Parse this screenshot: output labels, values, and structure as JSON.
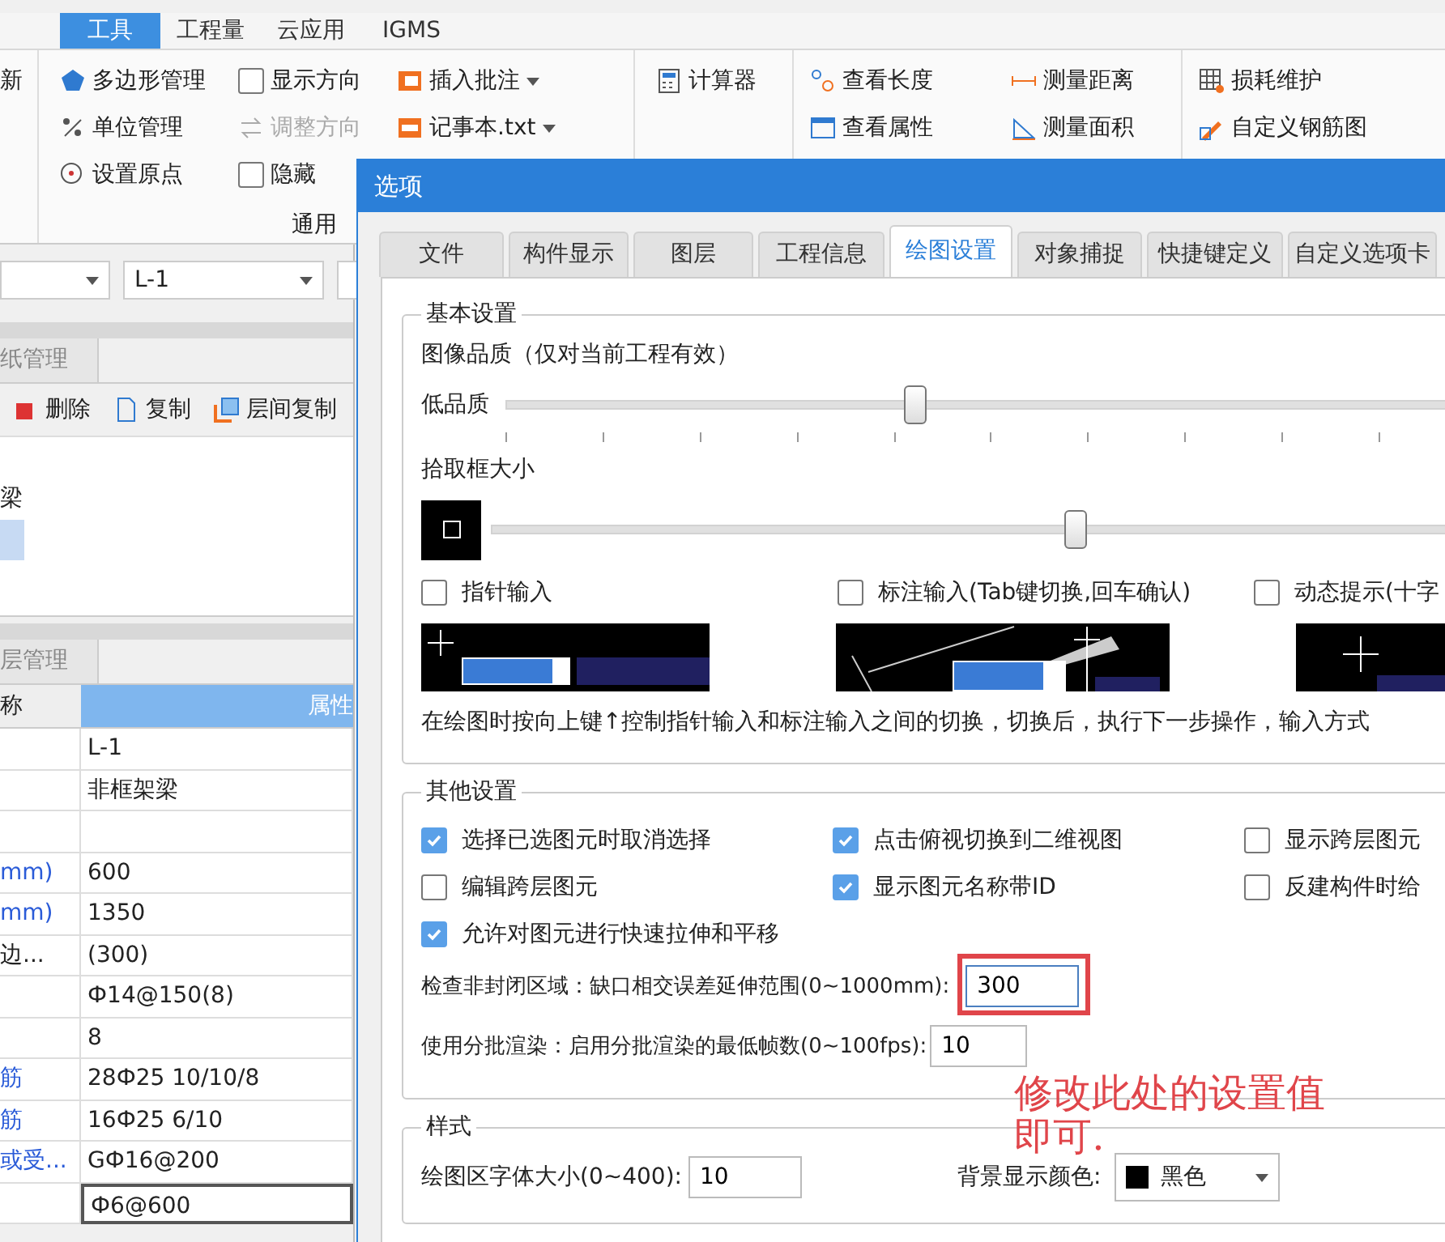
{
  "ribbon": {
    "tabs": [
      {
        "label": "工具",
        "selected": true
      },
      {
        "label": "工程量",
        "selected": false
      },
      {
        "label": "云应用",
        "selected": false
      },
      {
        "label": "IGMS",
        "selected": false
      }
    ],
    "edge_label": "新",
    "columns": [
      [
        {
          "kind": "button",
          "label": "多边形管理",
          "disabled": false
        },
        {
          "kind": "button",
          "label": "单位管理",
          "disabled": false
        },
        {
          "kind": "button",
          "label": "设置原点",
          "disabled": false
        }
      ],
      [
        {
          "kind": "checkbox",
          "label": "显示方向",
          "checked": false,
          "disabled": false
        },
        {
          "kind": "button",
          "label": "调整方向",
          "disabled": true
        },
        {
          "kind": "checkbox",
          "label": "隐藏",
          "checked": false,
          "disabled": false
        }
      ],
      [
        {
          "kind": "menu",
          "label": "插入批注",
          "disabled": false
        },
        {
          "kind": "menu",
          "label": "记事本.txt",
          "disabled": false
        }
      ],
      [
        {
          "kind": "button",
          "label": "计算器",
          "disabled": false
        }
      ],
      [
        {
          "kind": "button",
          "label": "查看长度",
          "disabled": false
        },
        {
          "kind": "button",
          "label": "查看属性",
          "disabled": false
        }
      ],
      [
        {
          "kind": "button",
          "label": "测量距离",
          "disabled": false
        },
        {
          "kind": "button",
          "label": "测量面积",
          "disabled": false
        }
      ],
      [
        {
          "kind": "button",
          "label": "损耗维护",
          "disabled": false
        },
        {
          "kind": "button",
          "label": "自定义钢筋图",
          "disabled": false
        }
      ]
    ],
    "group_label": "通用"
  },
  "left_panel": {
    "selector": "L-1",
    "drawing_tab": "纸管理",
    "toolbar": [
      "删除",
      "复制",
      "层间复制"
    ],
    "tree": [
      {
        "label": "梁",
        "selected": false
      },
      {
        "selected": true
      }
    ],
    "layer_tab": "层管理",
    "properties": {
      "columns": [
        "称",
        "属性"
      ],
      "rows": [
        {
          "value": "L-1",
          "editing": false
        },
        {
          "value": "非框架梁",
          "editing": false
        },
        {
          "editing": false
        },
        {
          "name": "mm)",
          "value": "600",
          "public": true,
          "editing": false
        },
        {
          "name": "mm)",
          "value": "1350",
          "public": true,
          "editing": false
        },
        {
          "name": "边...",
          "value": "(300)",
          "public": false,
          "editing": false
        },
        {
          "value": "Ф14@150(8)",
          "editing": false
        },
        {
          "value": "8",
          "editing": false
        },
        {
          "name": "筋",
          "value": "28Ф25 10/10/8",
          "public": true,
          "editing": false
        },
        {
          "name": "筋",
          "value": "16Ф25 6/10",
          "public": true,
          "editing": false
        },
        {
          "name": "或受...",
          "value": "GФ16@200",
          "public": true,
          "editing": false
        },
        {
          "value": "Ф6@600",
          "editing": true
        }
      ]
    }
  },
  "dialog": {
    "title": "选项",
    "tabs": [
      {
        "label": "文件",
        "selected": false
      },
      {
        "label": "构件显示",
        "selected": false
      },
      {
        "label": "图层",
        "selected": false
      },
      {
        "label": "工程信息",
        "selected": false
      },
      {
        "label": "绘图设置",
        "selected": true
      },
      {
        "label": "对象捕捉",
        "selected": false
      },
      {
        "label": "快捷键定义",
        "selected": false
      },
      {
        "label": "自定义选项卡",
        "selected": false
      }
    ],
    "basic": {
      "title": "基本设置",
      "quality_label": "图像品质（仅对当前工程有效）",
      "quality_slider": {
        "label": "低品质",
        "level": 0.42
      },
      "pick_label": "拾取框大小",
      "pick_slider": {
        "level": 0.6
      },
      "input_modes": [
        {
          "label": "指针输入",
          "checked": false
        },
        {
          "label": "标注输入(Tab键切换,回车确认)",
          "checked": false
        },
        {
          "label": "动态提示(十字",
          "checked": false
        }
      ],
      "hint": "在绘图时按向上键↑控制指针输入和标注输入之间的切换，切换后，执行下一步操作，输入方式"
    },
    "other": {
      "title": "其他设置",
      "options": [
        {
          "label": "选择已选图元时取消选择",
          "checked": true
        },
        {
          "label": "点击俯视切换到二维视图",
          "checked": true
        },
        {
          "label": "显示跨层图元",
          "checked": false
        },
        {
          "label": "编辑跨层图元",
          "checked": false
        },
        {
          "label": "显示图元名称带ID",
          "checked": true
        },
        {
          "label": "反建构件时给",
          "checked": false
        },
        {
          "label": "允许对图元进行快速拉伸和平移",
          "checked": true
        }
      ],
      "fields": [
        {
          "label": "检查非封闭区域：缺口相交误差延伸范围(0~1000mm):",
          "value": "300",
          "marked": true
        },
        {
          "label": "使用分批渲染：启用分批渲染的最低帧数(0~100fps):",
          "value": "10",
          "marked": false
        }
      ]
    },
    "style": {
      "title": "样式",
      "font_size": {
        "label": "绘图区字体大小(0~400):",
        "value": "10"
      },
      "background": {
        "label": "背景显示颜色:",
        "value": "黑色",
        "color": "#000000"
      }
    }
  },
  "annotation": {
    "text": "修改此处的设置值即可."
  }
}
